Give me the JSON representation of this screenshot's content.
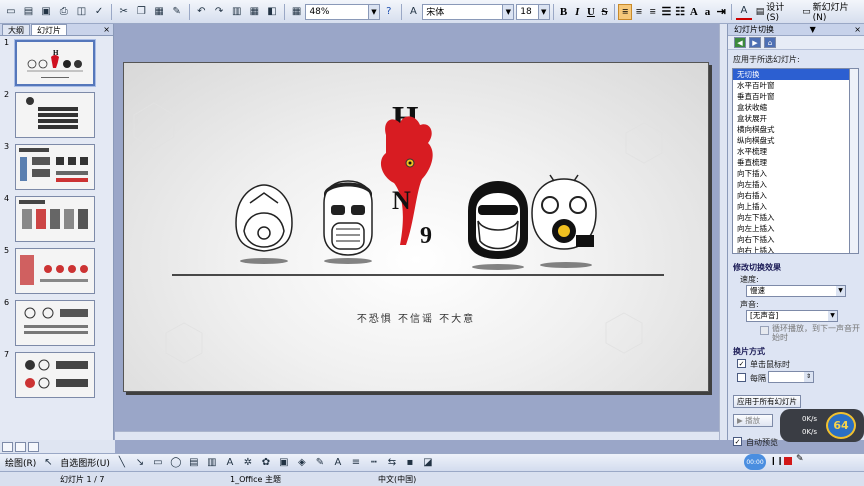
{
  "toolbar": {
    "zoom": "48%",
    "font_name": "宋体",
    "font_size": "18",
    "bold": "B",
    "italic": "I",
    "underline": "U",
    "strike": "S",
    "design_label": "设计(S)",
    "new_slide_label": "新幻灯片(N)"
  },
  "left_panel": {
    "tabs": [
      "大纲",
      "幻灯片"
    ],
    "close": "×",
    "slide_numbers": [
      "1",
      "2",
      "3",
      "4",
      "5",
      "6",
      "7"
    ]
  },
  "slide": {
    "title_letters": [
      "H",
      "N",
      "9"
    ],
    "caption": "不恐惧  不信谣  不大意"
  },
  "task_pane": {
    "title": "幻灯片切换",
    "apply_selected_label": "应用于所选幻灯片:",
    "transitions": [
      "无切换",
      "水平百叶窗",
      "垂直百叶窗",
      "盒状收缩",
      "盒状展开",
      "横向棋盘式",
      "纵向棋盘式",
      "水平梳理",
      "垂直梳理",
      "向下插入",
      "向左插入",
      "向右插入",
      "向上插入",
      "向左下插入",
      "向左上插入",
      "向右下插入",
      "向右上插入",
      "切出"
    ],
    "modify_section": "修改切换效果",
    "speed_label": "速度:",
    "speed_value": "慢速",
    "sound_label": "声音:",
    "sound_value": "[无声音]",
    "loop_label": "循环播放，到下一声音开始时",
    "advance_section": "换片方式",
    "on_click_label": "单击鼠标时",
    "every_label": "每隔",
    "apply_all_label": "应用于所有幻灯片",
    "play_label": "播放",
    "autopreview_label": "自动预览"
  },
  "draw_toolbar": {
    "draw_label": "绘图(R)",
    "autoshape_label": "自选图形(U)"
  },
  "status": {
    "slide_index": "幻灯片 1 / 7",
    "theme": "1_Office 主题",
    "language": "中文(中国)"
  },
  "overlay": {
    "upload": "0K/s",
    "download": "0K/s",
    "badge": "64",
    "timer": "00:00"
  }
}
